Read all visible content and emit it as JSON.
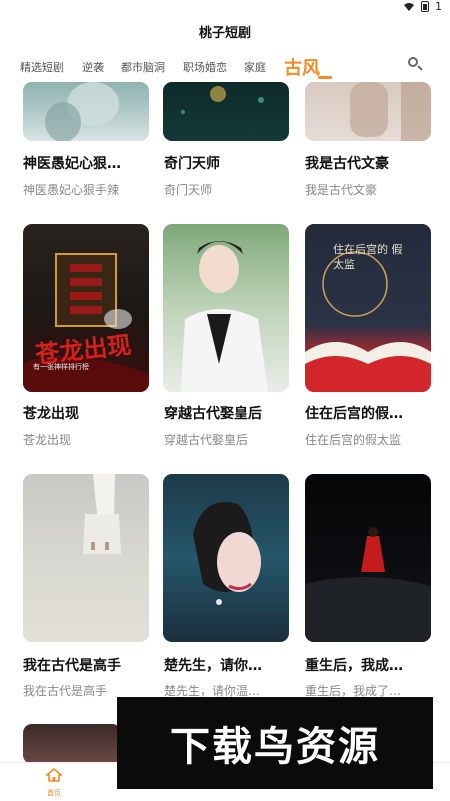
{
  "app_title": "桃子短剧",
  "status": {
    "battery_level": 1
  },
  "tabs": [
    {
      "label": "精选短剧",
      "active": false
    },
    {
      "label": "逆袭",
      "active": false
    },
    {
      "label": "都市脑洞",
      "active": false
    },
    {
      "label": "职场婚恋",
      "active": false
    },
    {
      "label": "家庭",
      "active": false
    },
    {
      "label": "古风",
      "active": true
    }
  ],
  "accent_color": "#F28C28",
  "rows": [
    {
      "cards": [
        {
          "title": "神医愚妃心狠…",
          "subtitle": "神医愚妃心狠手辣"
        },
        {
          "title": "奇门天师",
          "subtitle": "奇门天师"
        },
        {
          "title": "我是古代文豪",
          "subtitle": "我是古代文豪"
        }
      ]
    },
    {
      "cards": [
        {
          "title": "苍龙出现",
          "subtitle": "苍龙出现",
          "poster_text": "苍龙出现",
          "poster_caption": "有一张神样排行榜"
        },
        {
          "title": "穿越古代娶皇后",
          "subtitle": "穿越古代娶皇后"
        },
        {
          "title": "住在后宫的假…",
          "subtitle": "住在后宫的假太监",
          "poster_text": "住在后宫的 假太监"
        }
      ]
    },
    {
      "cards": [
        {
          "title": "我在古代是高手",
          "subtitle": "我在古代是高手"
        },
        {
          "title": "楚先生，请你…",
          "subtitle": "楚先生，请你温…"
        },
        {
          "title": "重生后，我成…",
          "subtitle": "重生后，我成了…"
        }
      ]
    }
  ],
  "bottom_nav": [
    {
      "label": "首页",
      "icon": "home-icon",
      "active": true
    },
    {
      "label": "",
      "icon": "grid-icon",
      "active": false
    },
    {
      "label": "",
      "icon": "history-icon",
      "active": false
    },
    {
      "label": "",
      "icon": "profile-icon",
      "active": false
    }
  ],
  "watermark": "下载鸟资源"
}
